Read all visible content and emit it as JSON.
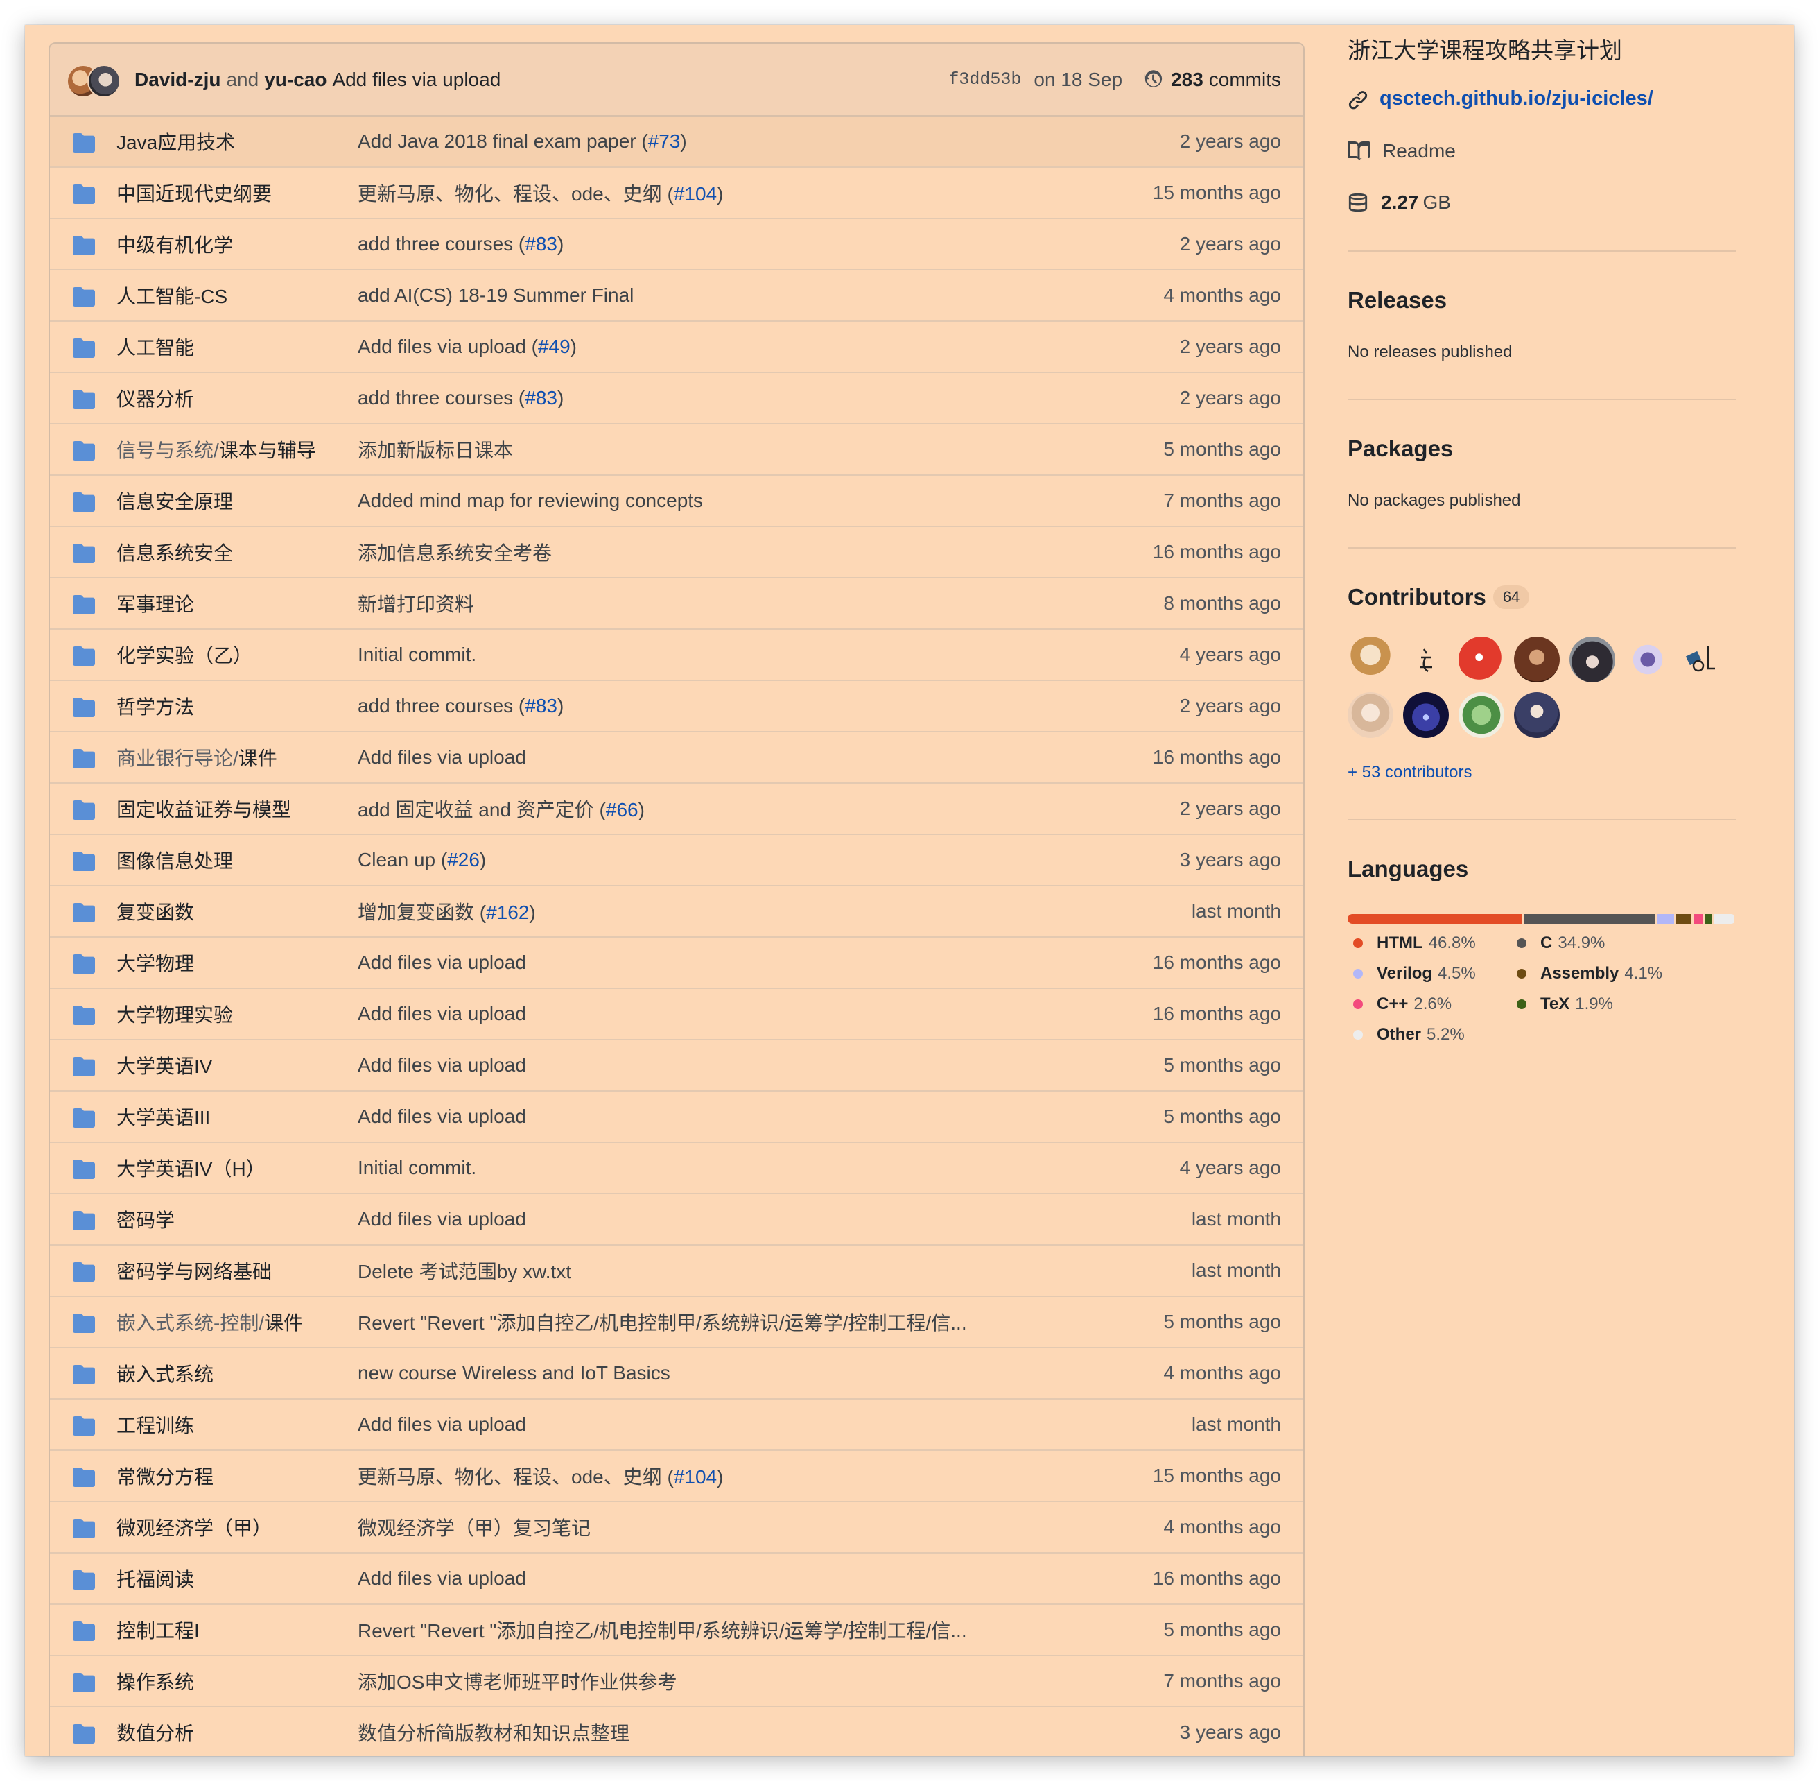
{
  "commit_bar": {
    "author1": "David-zju",
    "and": "and",
    "author2": "yu-cao",
    "message": "Add files via upload",
    "sha": "f3dd53b",
    "date": "on 18 Sep",
    "commit_count": "283",
    "commits_label": "commits"
  },
  "files": [
    {
      "name_dim": "",
      "name": "Java应用技术",
      "msg": "Add Java 2018 final exam paper (",
      "pr": "#73",
      "msg_end": ")",
      "age": "2 years ago"
    },
    {
      "name_dim": "",
      "name": "中国近现代史纲要",
      "msg": "更新马原、物化、程设、ode、史纲 (",
      "pr": "#104",
      "msg_end": ")",
      "age": "15 months ago"
    },
    {
      "name_dim": "",
      "name": "中级有机化学",
      "msg": "add three courses (",
      "pr": "#83",
      "msg_end": ")",
      "age": "2 years ago"
    },
    {
      "name_dim": "",
      "name": "人工智能-CS",
      "msg": "add AI(CS) 18-19 Summer Final",
      "pr": "",
      "msg_end": "",
      "age": "4 months ago"
    },
    {
      "name_dim": "",
      "name": "人工智能",
      "msg": "Add files via upload (",
      "pr": "#49",
      "msg_end": ")",
      "age": "2 years ago"
    },
    {
      "name_dim": "",
      "name": "仪器分析",
      "msg": "add three courses (",
      "pr": "#83",
      "msg_end": ")",
      "age": "2 years ago"
    },
    {
      "name_dim": "信号与系统/",
      "name": "课本与辅导",
      "msg": "添加新版标日课本",
      "pr": "",
      "msg_end": "",
      "age": "5 months ago"
    },
    {
      "name_dim": "",
      "name": "信息安全原理",
      "msg": "Added mind map for reviewing concepts",
      "pr": "",
      "msg_end": "",
      "age": "7 months ago"
    },
    {
      "name_dim": "",
      "name": "信息系统安全",
      "msg": "添加信息系统安全考卷",
      "pr": "",
      "msg_end": "",
      "age": "16 months ago"
    },
    {
      "name_dim": "",
      "name": "军事理论",
      "msg": "新增打印资料",
      "pr": "",
      "msg_end": "",
      "age": "8 months ago"
    },
    {
      "name_dim": "",
      "name": "化学实验（乙）",
      "msg": "Initial commit.",
      "pr": "",
      "msg_end": "",
      "age": "4 years ago"
    },
    {
      "name_dim": "",
      "name": "哲学方法",
      "msg": "add three courses (",
      "pr": "#83",
      "msg_end": ")",
      "age": "2 years ago"
    },
    {
      "name_dim": "商业银行导论/",
      "name": "课件",
      "msg": "Add files via upload",
      "pr": "",
      "msg_end": "",
      "age": "16 months ago"
    },
    {
      "name_dim": "",
      "name": "固定收益证券与模型",
      "msg": "add 固定收益 and 资产定价 (",
      "pr": "#66",
      "msg_end": ")",
      "age": "2 years ago"
    },
    {
      "name_dim": "",
      "name": "图像信息处理",
      "msg": "Clean up (",
      "pr": "#26",
      "msg_end": ")",
      "age": "3 years ago"
    },
    {
      "name_dim": "",
      "name": "复变函数",
      "msg": "增加复变函数 (",
      "pr": "#162",
      "msg_end": ")",
      "age": "last month"
    },
    {
      "name_dim": "",
      "name": "大学物理",
      "msg": "Add files via upload",
      "pr": "",
      "msg_end": "",
      "age": "16 months ago"
    },
    {
      "name_dim": "",
      "name": "大学物理实验",
      "msg": "Add files via upload",
      "pr": "",
      "msg_end": "",
      "age": "16 months ago"
    },
    {
      "name_dim": "",
      "name": "大学英语IV",
      "msg": "Add files via upload",
      "pr": "",
      "msg_end": "",
      "age": "5 months ago"
    },
    {
      "name_dim": "",
      "name": "大学英语III",
      "msg": "Add files via upload",
      "pr": "",
      "msg_end": "",
      "age": "5 months ago"
    },
    {
      "name_dim": "",
      "name": "大学英语IV（H）",
      "msg": "Initial commit.",
      "pr": "",
      "msg_end": "",
      "age": "4 years ago"
    },
    {
      "name_dim": "",
      "name": "密码学",
      "msg": "Add files via upload",
      "pr": "",
      "msg_end": "",
      "age": "last month"
    },
    {
      "name_dim": "",
      "name": "密码学与网络基础",
      "msg": "Delete 考试范围by xw.txt",
      "pr": "",
      "msg_end": "",
      "age": "last month"
    },
    {
      "name_dim": "嵌入式系统-控制/",
      "name": "课件",
      "msg": "Revert \"Revert \"添加自控乙/机电控制甲/系统辨识/运筹学/控制工程/信...",
      "pr": "",
      "msg_end": "",
      "age": "5 months ago"
    },
    {
      "name_dim": "",
      "name": "嵌入式系统",
      "msg": "new course Wireless and IoT Basics",
      "pr": "",
      "msg_end": "",
      "age": "4 months ago"
    },
    {
      "name_dim": "",
      "name": "工程训练",
      "msg": "Add files via upload",
      "pr": "",
      "msg_end": "",
      "age": "last month"
    },
    {
      "name_dim": "",
      "name": "常微分方程",
      "msg": "更新马原、物化、程设、ode、史纲 (",
      "pr": "#104",
      "msg_end": ")",
      "age": "15 months ago"
    },
    {
      "name_dim": "",
      "name": "微观经济学（甲）",
      "msg": "微观经济学（甲）复习笔记",
      "pr": "",
      "msg_end": "",
      "age": "4 months ago"
    },
    {
      "name_dim": "",
      "name": "托福阅读",
      "msg": "Add files via upload",
      "pr": "",
      "msg_end": "",
      "age": "16 months ago"
    },
    {
      "name_dim": "",
      "name": "控制工程I",
      "msg": "Revert \"Revert \"添加自控乙/机电控制甲/系统辨识/运筹学/控制工程/信...",
      "pr": "",
      "msg_end": "",
      "age": "5 months ago"
    },
    {
      "name_dim": "",
      "name": "操作系统",
      "msg": "添加OS申文博老师班平时作业供参考",
      "pr": "",
      "msg_end": "",
      "age": "7 months ago"
    },
    {
      "name_dim": "",
      "name": "数值分析",
      "msg": "数值分析简版教材和知识点整理",
      "pr": "",
      "msg_end": "",
      "age": "3 years ago"
    }
  ],
  "sidebar": {
    "about": "浙江大学课程攻略共享计划",
    "link": "qsctech.github.io/zju-icicles/",
    "readme": "Readme",
    "size_value": "2.27",
    "size_unit": "GB",
    "releases_title": "Releases",
    "releases_sub": "No releases published",
    "packages_title": "Packages",
    "packages_sub": "No packages published",
    "contributors_title": "Contributors",
    "contributors_count": "64",
    "more_contributors": "+ 53 contributors",
    "languages_title": "Languages",
    "languages": [
      {
        "name": "HTML",
        "pct": "46.8%",
        "color": "#e34c26",
        "share": 46.8
      },
      {
        "name": "C",
        "pct": "34.9%",
        "color": "#555555",
        "share": 34.9
      },
      {
        "name": "Verilog",
        "pct": "4.5%",
        "color": "#b2b7f8",
        "share": 4.5
      },
      {
        "name": "Assembly",
        "pct": "4.1%",
        "color": "#6e4c13",
        "share": 4.1
      },
      {
        "name": "C++",
        "pct": "2.6%",
        "color": "#f34b7d",
        "share": 2.6
      },
      {
        "name": "TeX",
        "pct": "1.9%",
        "color": "#3d6117",
        "share": 1.9
      },
      {
        "name": "Other",
        "pct": "5.2%",
        "color": "#ededed",
        "share": 5.2
      }
    ]
  },
  "icons": {
    "folder": "folder-icon",
    "history": "history-icon",
    "link": "link-icon",
    "book": "book-icon",
    "database": "database-icon"
  }
}
